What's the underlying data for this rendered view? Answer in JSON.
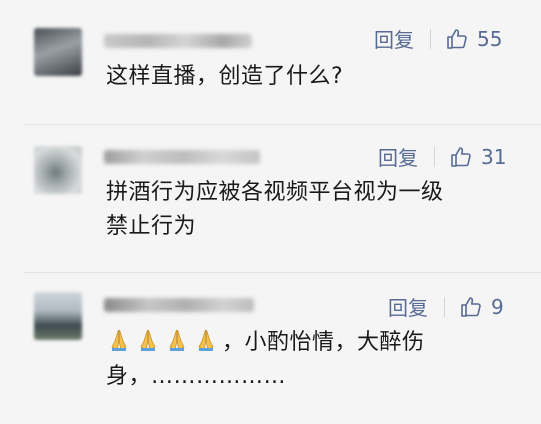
{
  "comments": [
    {
      "reply_label": "回复",
      "like_count": "55",
      "content": "这样直播，创造了什么?"
    },
    {
      "reply_label": "回复",
      "like_count": "31",
      "content_line1": "拼酒行为应被各视频平台视为一级",
      "content_line2": "禁止行为"
    },
    {
      "reply_label": "回复",
      "like_count": "9",
      "emoji_name": "folded-hands-icon",
      "content_line1_text": "，小酌怡情，大醉伤",
      "content_line2": "身，………………"
    }
  ],
  "colors": {
    "link": "#576b95",
    "text": "#1a1a1a",
    "background": "#f5f5f5",
    "divider": "#e3e3e3"
  }
}
